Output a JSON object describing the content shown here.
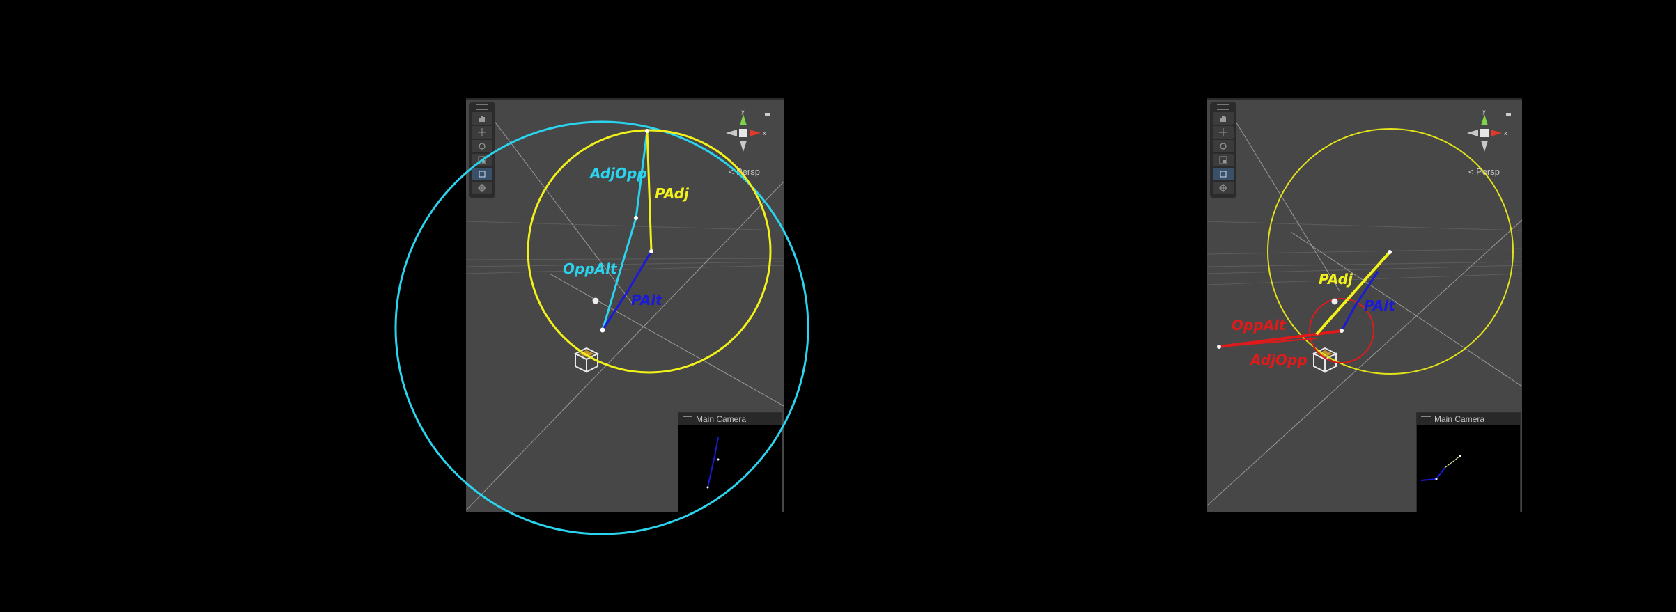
{
  "left_panel": {
    "persp_label": "< Persp",
    "camera_title": "Main Camera",
    "gizmo": {
      "y_label": "y",
      "x_label": "x"
    },
    "toolbar_tools": [
      "grip",
      "hand-tool-icon",
      "move-tool-icon",
      "rotate-tool-icon",
      "scale-tool-icon",
      "rect-tool-icon",
      "transform-tool-icon"
    ],
    "annotations": {
      "adj_opp": "AdjOpp",
      "p_adj": "PAdj",
      "opp_alt": "OppAlt",
      "p_alt": "PAlt"
    }
  },
  "right_panel": {
    "persp_label": "< Persp",
    "camera_title": "Main Camera",
    "gizmo": {
      "y_label": "y",
      "x_label": "x"
    },
    "toolbar_tools": [
      "grip",
      "hand-tool-icon",
      "move-tool-icon",
      "rotate-tool-icon",
      "scale-tool-icon",
      "rect-tool-icon",
      "transform-tool-icon"
    ],
    "annotations": {
      "p_adj": "PAdj",
      "p_alt": "PAlt",
      "opp_alt": "OppAlt",
      "adj_opp": "AdjOpp"
    }
  },
  "colors": {
    "cyan": "#2ad4ee",
    "yellow": "#f2f21a",
    "blue": "#1a1ad8",
    "red": "#e01a1a",
    "viewport_bg": "#474747"
  }
}
